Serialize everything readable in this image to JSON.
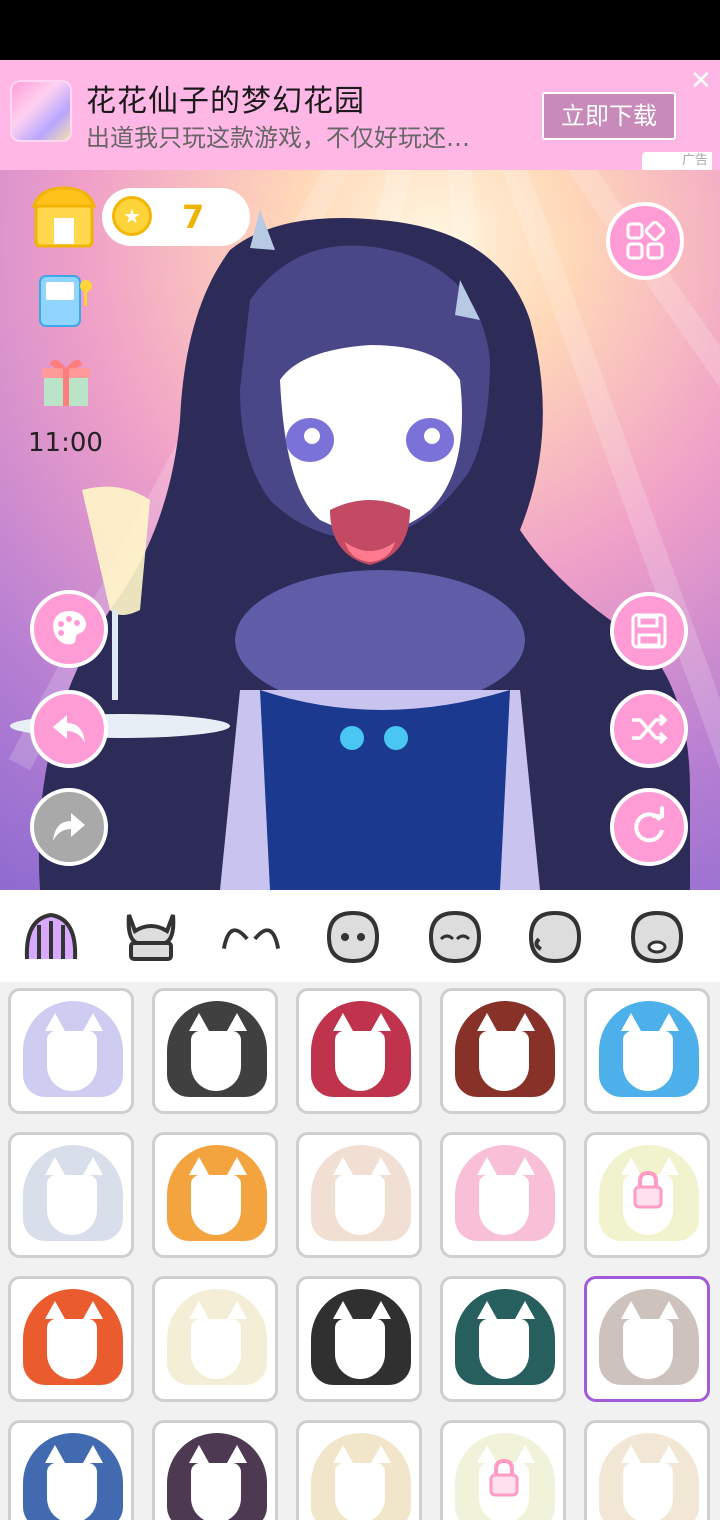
{
  "ad": {
    "title": "花花仙子的梦幻花园",
    "subtitle": "出道我只玩这款游戏，不仅好玩还…",
    "button": "立即下载",
    "close": "✕",
    "mark": "广告"
  },
  "hud": {
    "coins": "7",
    "timer": "11:00"
  },
  "icons": {
    "shop": "shop-icon",
    "coin": "star-coin-icon",
    "arcade": "game-machine-icon",
    "gift": "gift-icon",
    "menu": "grid-menu-icon",
    "palette": "palette-icon",
    "undo": "undo-icon",
    "redo": "redo-icon",
    "save": "save-icon",
    "shuffle": "shuffle-icon",
    "reset": "reset-icon"
  },
  "category_tabs": [
    "hair",
    "horns",
    "ears",
    "face",
    "eyes",
    "cheek",
    "mouth"
  ],
  "colors": {
    "accent": "#ff9cd6",
    "ad_bg": "#ffb8e6",
    "selected": "#a25ad8"
  },
  "hair_items": [
    {
      "color": "#c9c6ee",
      "locked": false
    },
    {
      "color": "#2b2b2b",
      "locked": false
    },
    {
      "color": "#b81d3a",
      "locked": false
    },
    {
      "color": "#7b1b12",
      "locked": false
    },
    {
      "color": "#3aa7e8",
      "locked": false
    },
    {
      "color": "#d4dbe8",
      "locked": false
    },
    {
      "color": "#f39a2a",
      "locked": false
    },
    {
      "color": "#efdbcf",
      "locked": false
    },
    {
      "color": "#f7b8d3",
      "locked": false
    },
    {
      "color": "#eef2c9",
      "locked": true
    },
    {
      "color": "#e84a17",
      "locked": false
    },
    {
      "color": "#f3ecd2",
      "locked": false
    },
    {
      "color": "#1a1a1a",
      "locked": false
    },
    {
      "color": "#0f4d4d",
      "locked": false
    },
    {
      "color": "#c8bcb5",
      "locked": false
    },
    {
      "color": "#2c5aa8",
      "locked": false
    },
    {
      "color": "#3b2440",
      "locked": false
    },
    {
      "color": "#f0e3c4",
      "locked": false
    },
    {
      "color": "#eef2d6",
      "locked": true
    },
    {
      "color": "#f1e4cf",
      "locked": false
    }
  ],
  "selected_index": 14
}
